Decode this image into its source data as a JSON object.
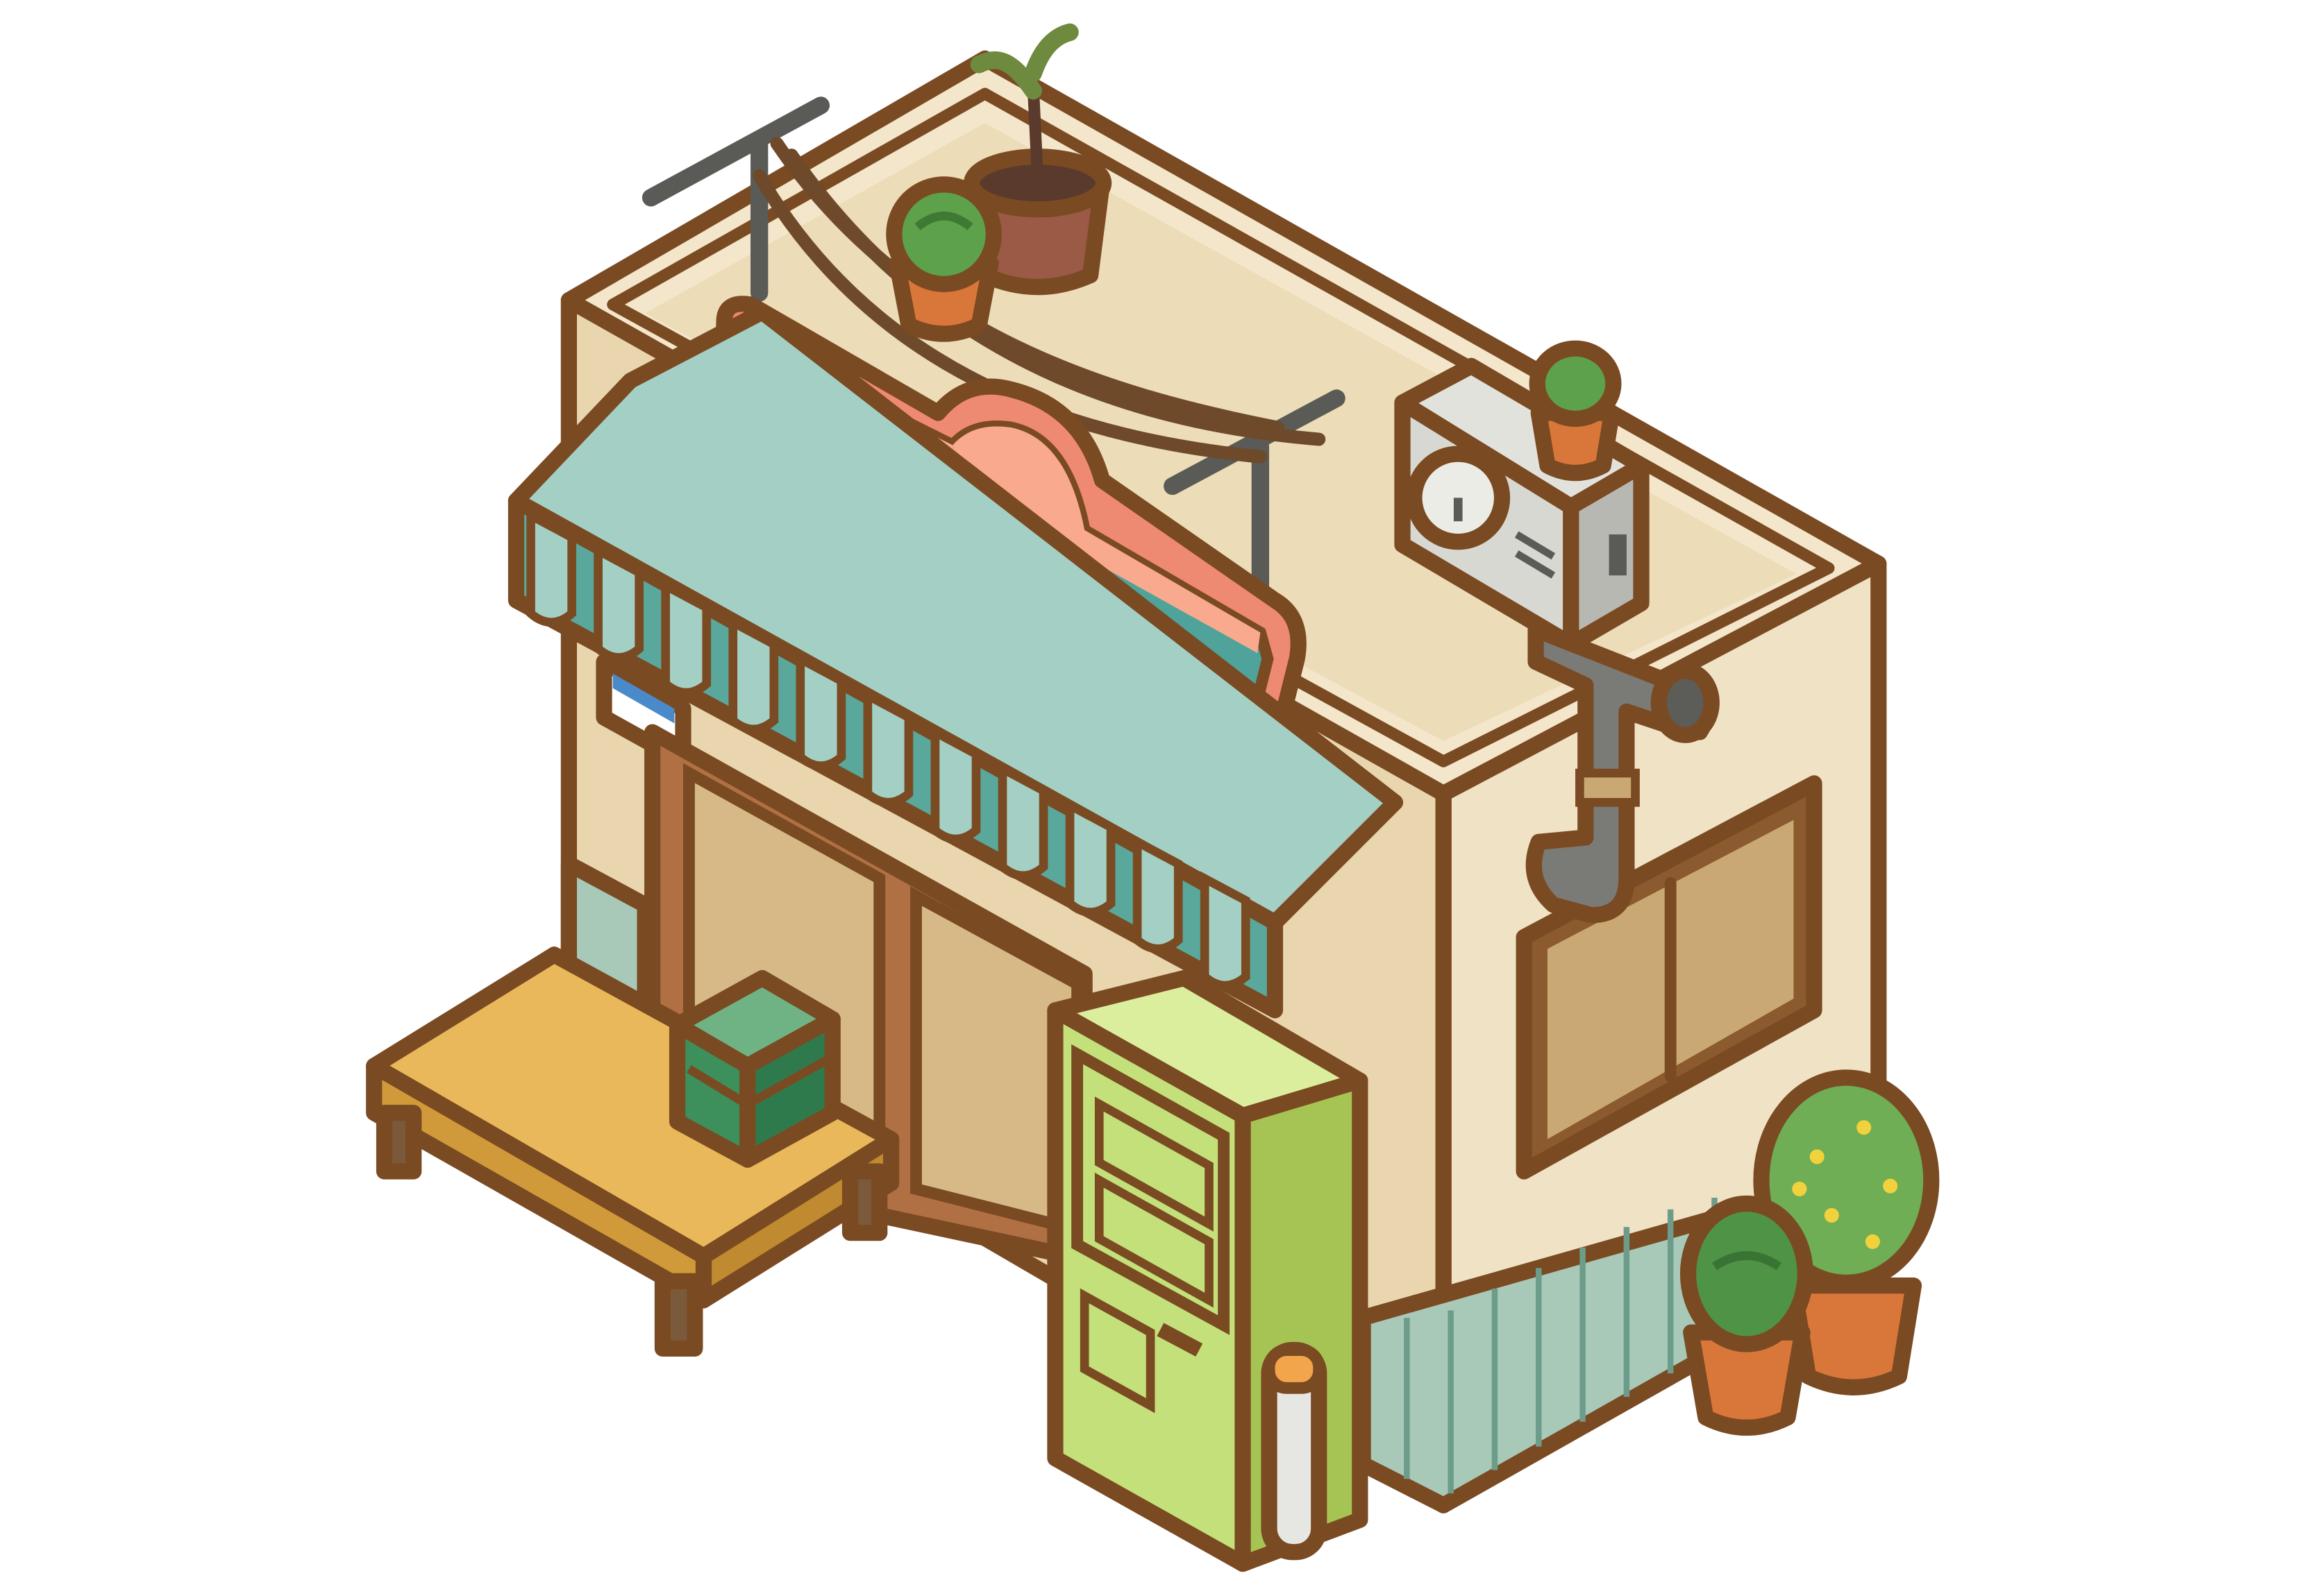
{
  "scene": {
    "palette": {
      "wall": "#f0e2c4",
      "wall_shade": "#e4cfa4",
      "roof_top": "#e8d4ae",
      "awning_light": "#a3cfc4",
      "awning_dark": "#5aa79b",
      "sign_frame": "#ef8a72",
      "sign_peach": "#f8a98e",
      "sign_teal": "#4fa39a",
      "sign_dot": "#f6b24e",
      "bench_top": "#e8b85a",
      "bench_side": "#d09a3a",
      "crate": "#3d8f5c",
      "vending": "#c4e07a",
      "vending_side": "#a6c454",
      "pipe": "#7a7a76",
      "ac_unit": "#d8d8d2",
      "pot": "#d9763a",
      "plant": "#5ea14b",
      "flower": "#f2d23c",
      "outline": "#7a4a22"
    },
    "icons": [
      "potted-plant-icon",
      "ac-unit-icon",
      "antenna-icon",
      "vending-machine-icon",
      "bench-icon",
      "crate-icon",
      "drain-pipe-icon",
      "window-icon",
      "shop-sign-icon",
      "awning-icon"
    ]
  }
}
